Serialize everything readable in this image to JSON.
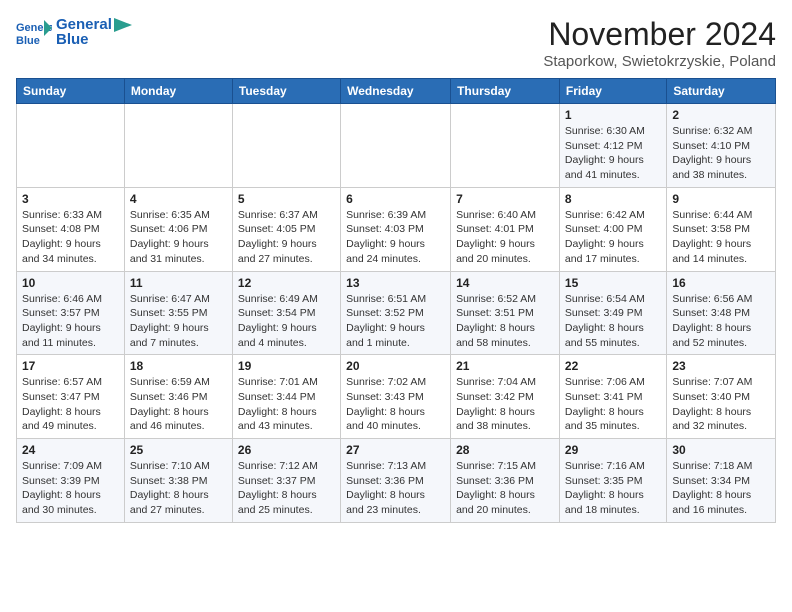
{
  "header": {
    "logo_line1": "General",
    "logo_line2": "Blue",
    "month": "November 2024",
    "location": "Staporkow, Swietokrzyskie, Poland"
  },
  "weekdays": [
    "Sunday",
    "Monday",
    "Tuesday",
    "Wednesday",
    "Thursday",
    "Friday",
    "Saturday"
  ],
  "weeks": [
    [
      {
        "day": "",
        "info": ""
      },
      {
        "day": "",
        "info": ""
      },
      {
        "day": "",
        "info": ""
      },
      {
        "day": "",
        "info": ""
      },
      {
        "day": "",
        "info": ""
      },
      {
        "day": "1",
        "info": "Sunrise: 6:30 AM\nSunset: 4:12 PM\nDaylight: 9 hours\nand 41 minutes."
      },
      {
        "day": "2",
        "info": "Sunrise: 6:32 AM\nSunset: 4:10 PM\nDaylight: 9 hours\nand 38 minutes."
      }
    ],
    [
      {
        "day": "3",
        "info": "Sunrise: 6:33 AM\nSunset: 4:08 PM\nDaylight: 9 hours\nand 34 minutes."
      },
      {
        "day": "4",
        "info": "Sunrise: 6:35 AM\nSunset: 4:06 PM\nDaylight: 9 hours\nand 31 minutes."
      },
      {
        "day": "5",
        "info": "Sunrise: 6:37 AM\nSunset: 4:05 PM\nDaylight: 9 hours\nand 27 minutes."
      },
      {
        "day": "6",
        "info": "Sunrise: 6:39 AM\nSunset: 4:03 PM\nDaylight: 9 hours\nand 24 minutes."
      },
      {
        "day": "7",
        "info": "Sunrise: 6:40 AM\nSunset: 4:01 PM\nDaylight: 9 hours\nand 20 minutes."
      },
      {
        "day": "8",
        "info": "Sunrise: 6:42 AM\nSunset: 4:00 PM\nDaylight: 9 hours\nand 17 minutes."
      },
      {
        "day": "9",
        "info": "Sunrise: 6:44 AM\nSunset: 3:58 PM\nDaylight: 9 hours\nand 14 minutes."
      }
    ],
    [
      {
        "day": "10",
        "info": "Sunrise: 6:46 AM\nSunset: 3:57 PM\nDaylight: 9 hours\nand 11 minutes."
      },
      {
        "day": "11",
        "info": "Sunrise: 6:47 AM\nSunset: 3:55 PM\nDaylight: 9 hours\nand 7 minutes."
      },
      {
        "day": "12",
        "info": "Sunrise: 6:49 AM\nSunset: 3:54 PM\nDaylight: 9 hours\nand 4 minutes."
      },
      {
        "day": "13",
        "info": "Sunrise: 6:51 AM\nSunset: 3:52 PM\nDaylight: 9 hours\nand 1 minute."
      },
      {
        "day": "14",
        "info": "Sunrise: 6:52 AM\nSunset: 3:51 PM\nDaylight: 8 hours\nand 58 minutes."
      },
      {
        "day": "15",
        "info": "Sunrise: 6:54 AM\nSunset: 3:49 PM\nDaylight: 8 hours\nand 55 minutes."
      },
      {
        "day": "16",
        "info": "Sunrise: 6:56 AM\nSunset: 3:48 PM\nDaylight: 8 hours\nand 52 minutes."
      }
    ],
    [
      {
        "day": "17",
        "info": "Sunrise: 6:57 AM\nSunset: 3:47 PM\nDaylight: 8 hours\nand 49 minutes."
      },
      {
        "day": "18",
        "info": "Sunrise: 6:59 AM\nSunset: 3:46 PM\nDaylight: 8 hours\nand 46 minutes."
      },
      {
        "day": "19",
        "info": "Sunrise: 7:01 AM\nSunset: 3:44 PM\nDaylight: 8 hours\nand 43 minutes."
      },
      {
        "day": "20",
        "info": "Sunrise: 7:02 AM\nSunset: 3:43 PM\nDaylight: 8 hours\nand 40 minutes."
      },
      {
        "day": "21",
        "info": "Sunrise: 7:04 AM\nSunset: 3:42 PM\nDaylight: 8 hours\nand 38 minutes."
      },
      {
        "day": "22",
        "info": "Sunrise: 7:06 AM\nSunset: 3:41 PM\nDaylight: 8 hours\nand 35 minutes."
      },
      {
        "day": "23",
        "info": "Sunrise: 7:07 AM\nSunset: 3:40 PM\nDaylight: 8 hours\nand 32 minutes."
      }
    ],
    [
      {
        "day": "24",
        "info": "Sunrise: 7:09 AM\nSunset: 3:39 PM\nDaylight: 8 hours\nand 30 minutes."
      },
      {
        "day": "25",
        "info": "Sunrise: 7:10 AM\nSunset: 3:38 PM\nDaylight: 8 hours\nand 27 minutes."
      },
      {
        "day": "26",
        "info": "Sunrise: 7:12 AM\nSunset: 3:37 PM\nDaylight: 8 hours\nand 25 minutes."
      },
      {
        "day": "27",
        "info": "Sunrise: 7:13 AM\nSunset: 3:36 PM\nDaylight: 8 hours\nand 23 minutes."
      },
      {
        "day": "28",
        "info": "Sunrise: 7:15 AM\nSunset: 3:36 PM\nDaylight: 8 hours\nand 20 minutes."
      },
      {
        "day": "29",
        "info": "Sunrise: 7:16 AM\nSunset: 3:35 PM\nDaylight: 8 hours\nand 18 minutes."
      },
      {
        "day": "30",
        "info": "Sunrise: 7:18 AM\nSunset: 3:34 PM\nDaylight: 8 hours\nand 16 minutes."
      }
    ]
  ]
}
